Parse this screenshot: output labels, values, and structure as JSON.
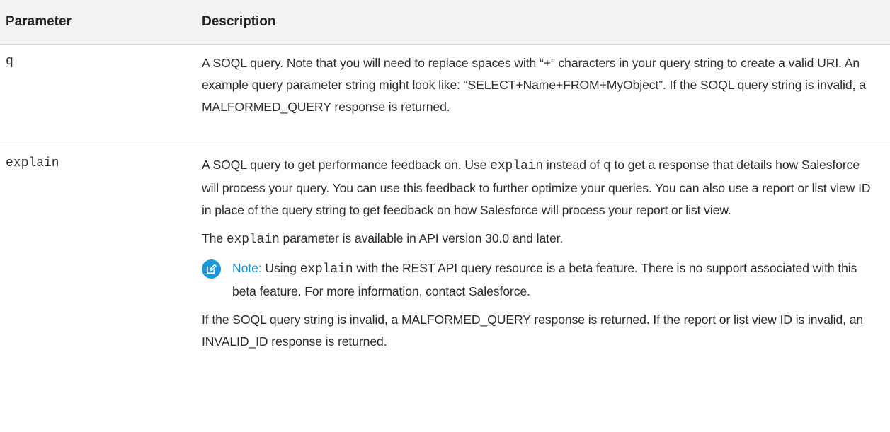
{
  "table": {
    "headers": {
      "parameter": "Parameter",
      "description": "Description"
    },
    "rows": [
      {
        "param": "q",
        "description": {
          "p1": "A SOQL query. Note that you will need to replace spaces with “+” characters in your query string to create a valid URI. An example query parameter string might look like: “SELECT+Name+FROM+MyObject”. If the SOQL query string is invalid, a MALFORMED_QUERY response is returned."
        }
      },
      {
        "param": "explain",
        "description": {
          "p1_a": "A SOQL query to get performance feedback on. Use ",
          "p1_code1": "explain",
          "p1_b": " instead of ",
          "p1_code2": "q",
          "p1_c": " to get a response that details how Salesforce will process your query. You can use this feedback to further optimize your queries. You can also use a report or list view ID in place of the query string to get feedback on how Salesforce will process your report or list view.",
          "p2_a": "The ",
          "p2_code": "explain",
          "p2_b": " parameter is available in API version 30.0 and later.",
          "note_label": "Note:",
          "note_a": " Using ",
          "note_code": "explain",
          "note_b": " with the REST API query resource is a beta feature. There is no support associated with this beta feature. For more information, contact Salesforce.",
          "p3": "If the SOQL query string is invalid, a MALFORMED_QUERY response is returned. If the report or list view ID is invalid, an INVALID_ID response is returned."
        }
      }
    ]
  },
  "icons": {
    "note_icon": "edit-note-icon"
  },
  "colors": {
    "accent": "#1b96d6",
    "header_bg": "#f3f3f3",
    "divider": "#dcdcdc"
  }
}
